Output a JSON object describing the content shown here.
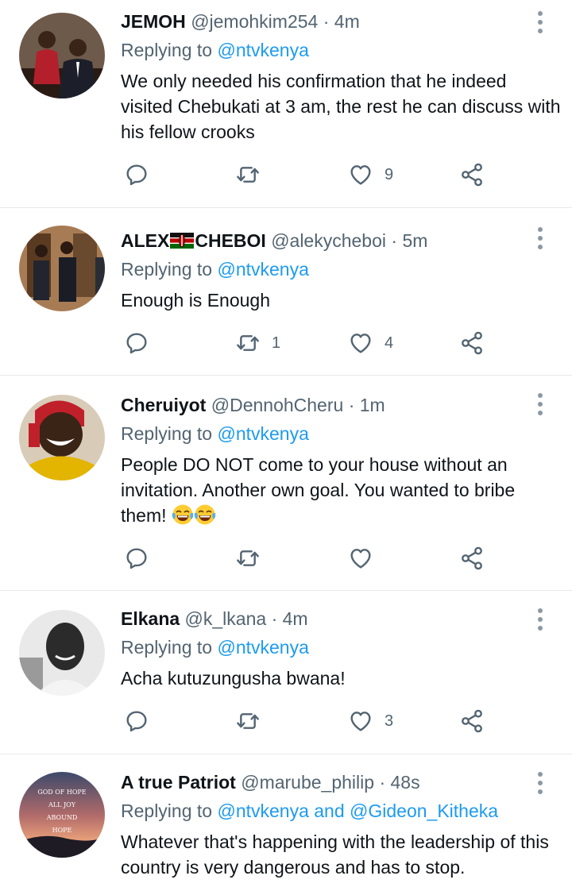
{
  "tweets": [
    {
      "name": "JEMOH",
      "handle": "@jemohkim254",
      "time": "4m",
      "replying_prefix": "Replying to ",
      "replying_to": "@ntvkenya",
      "text": "We only needed his confirmation that he indeed visited Chebukati at 3 am, the rest he can discuss with his fellow crooks",
      "replies": "",
      "retweets": "",
      "likes": "9"
    },
    {
      "name_part1": "ALEX",
      "name_part2": "CHEBOI",
      "flag_icon": "kenya-flag-emoji",
      "handle": "@alekycheboi",
      "time": "5m",
      "replying_prefix": "Replying to ",
      "replying_to": "@ntvkenya",
      "text": "Enough is Enough",
      "replies": "",
      "retweets": "1",
      "likes": "4"
    },
    {
      "name": "Cheruiyot",
      "handle": "@DennohCheru",
      "time": "1m",
      "replying_prefix": "Replying to ",
      "replying_to": "@ntvkenya",
      "text": "People DO NOT come to your house without an invitation. Another own goal. You wanted to bribe them!",
      "emoji_icon": "tears-of-joy-emoji",
      "replies": "",
      "retweets": "",
      "likes": ""
    },
    {
      "name": "Elkana",
      "handle": "@k_lkana",
      "time": "4m",
      "replying_prefix": "Replying to ",
      "replying_to": "@ntvkenya",
      "text": "Acha kutuzungusha bwana!",
      "replies": "",
      "retweets": "",
      "likes": "3"
    },
    {
      "name": "A true Patriot",
      "handle": "@marube_philip",
      "time": "48s",
      "replying_prefix": "Replying to ",
      "replying_to": "@ntvkenya and @Gideon_Kitheka",
      "text": "Whatever that's happening with the leadership of this country is very dangerous and has to stop.",
      "avatar_text": [
        "GOD OF HOPE",
        "ALL JOY",
        "ABOUND",
        "HOPE"
      ]
    }
  ],
  "dot_separator": "·",
  "colors": {
    "link": "#1d9bf0",
    "secondary_text": "#536471",
    "primary_text": "#0f1419",
    "divider": "#e6e8ea"
  },
  "icons": [
    "reply-icon",
    "retweet-icon",
    "like-icon",
    "share-icon",
    "more-icon"
  ]
}
